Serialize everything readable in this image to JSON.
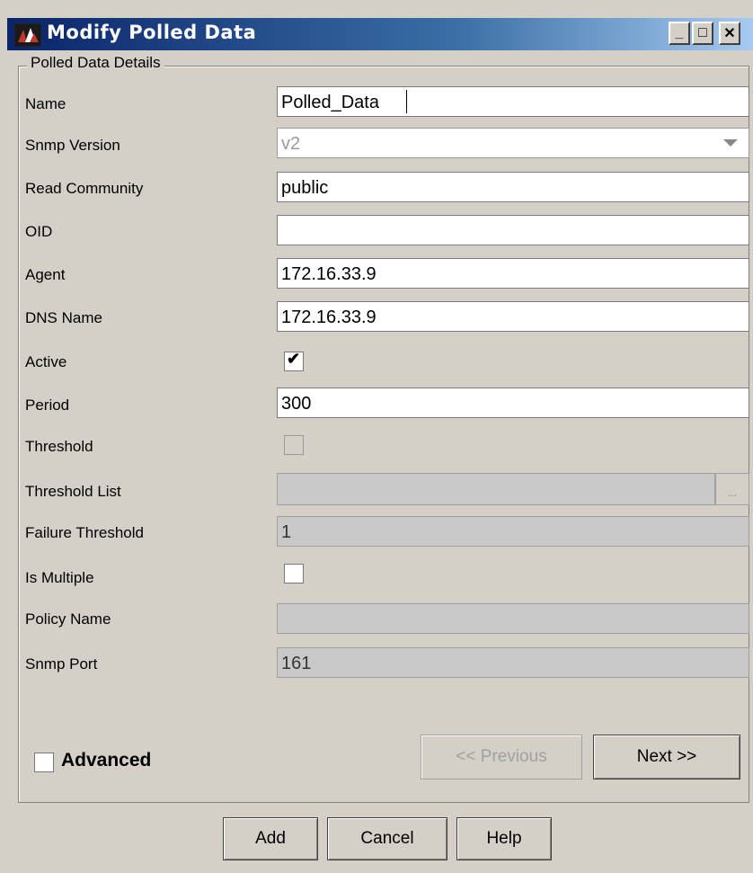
{
  "window": {
    "title": "Modify Polled Data",
    "controls": {
      "minimize": "_",
      "maximize": "□",
      "close": "✕"
    }
  },
  "group_title": "Polled Data Details",
  "fields": {
    "name": {
      "label": "Name",
      "value": "Polled_Data"
    },
    "snmp_version": {
      "label": "Snmp Version",
      "value": "v2"
    },
    "read_community": {
      "label": "Read Community",
      "value": "public"
    },
    "oid": {
      "label": "OID",
      "value": ""
    },
    "agent": {
      "label": "Agent",
      "value": "172.16.33.9"
    },
    "dns_name": {
      "label": "DNS Name",
      "value": "172.16.33.9"
    },
    "active": {
      "label": "Active",
      "checked": true,
      "mark": "✔"
    },
    "period": {
      "label": "Period",
      "value": "300"
    },
    "threshold": {
      "label": "Threshold",
      "checked": false
    },
    "threshold_list": {
      "label": "Threshold List",
      "value": "",
      "button": "..."
    },
    "failure_threshold": {
      "label": "Failure Threshold",
      "value": "1"
    },
    "is_multiple": {
      "label": "Is Multiple",
      "checked": false
    },
    "policy_name": {
      "label": "Policy Name",
      "value": ""
    },
    "snmp_port": {
      "label": "Snmp Port",
      "value": "161"
    }
  },
  "advanced": {
    "label": "Advanced",
    "checked": false
  },
  "nav": {
    "previous": "<< Previous",
    "next": "Next >>"
  },
  "buttons": {
    "add": "Add",
    "cancel": "Cancel",
    "help": "Help"
  }
}
